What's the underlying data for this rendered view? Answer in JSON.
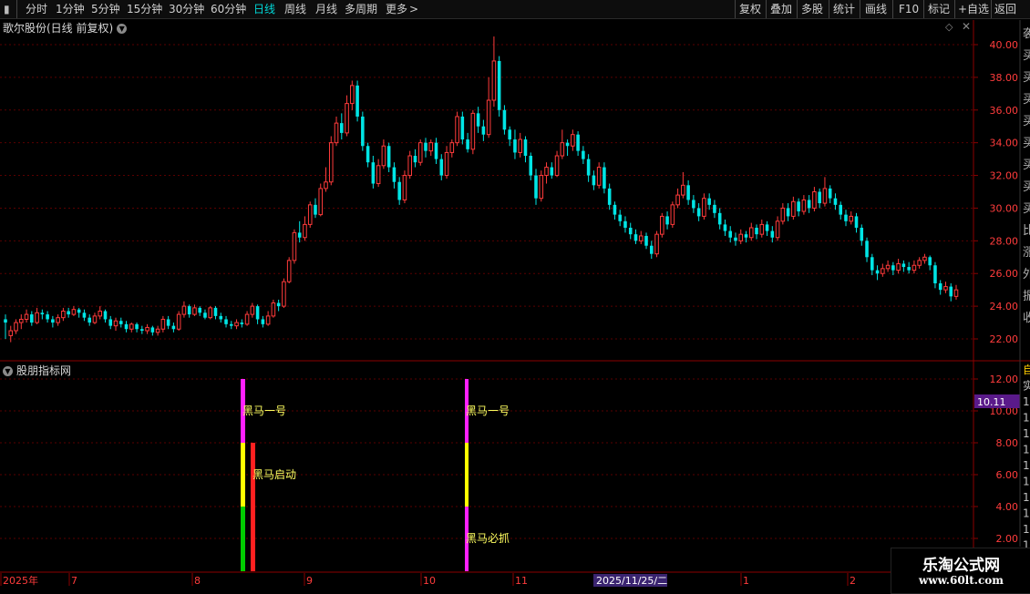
{
  "toolbar": {
    "periods": [
      "分时",
      "1分钟",
      "5分钟",
      "15分钟",
      "30分钟",
      "60分钟",
      "日线",
      "周线",
      "月线",
      "多周期",
      "更多"
    ],
    "active_period": "日线",
    "more_arrow": ">",
    "right_buttons": [
      "复权",
      "叠加",
      "多股",
      "统计",
      "画线",
      "F10",
      "标记",
      "+自选",
      "返回"
    ]
  },
  "main_chart": {
    "title": "歌尔股份(日线 前复权)",
    "y_ticks": [
      "40.00",
      "38.00",
      "36.00",
      "34.00",
      "32.00",
      "30.00",
      "28.00",
      "26.00",
      "24.00",
      "22.00"
    ],
    "colors": {
      "up": "#ff3b3b",
      "down": "#00e5e5",
      "grid": "#5a0000",
      "axis": "#8b0000",
      "tick_text": "#ff3c3c"
    }
  },
  "indicator": {
    "title": "股朋指标网",
    "y_ticks": [
      "12.00",
      "10.00",
      "8.00",
      "6.00",
      "4.00",
      "2.00"
    ],
    "current_value": "10.11",
    "labels": [
      "黑马一号",
      "黑马启动",
      "黑马一号",
      "黑马必抓"
    ],
    "colors": {
      "magenta": "#ff20ff",
      "yellow": "#ffff00",
      "green": "#00cc00",
      "red": "#ff2020",
      "label": "#ffff60",
      "value_bg": "#5a1a8a"
    }
  },
  "x_axis": {
    "labels": [
      "2025年",
      "7",
      "8",
      "9",
      "10",
      "11",
      "1",
      "2"
    ],
    "cursor_date": "2025/11/25/二"
  },
  "right_panel_strip": {
    "chars_top": [
      "袭",
      "买",
      "买",
      "买",
      "买",
      "买",
      "买",
      "买",
      "买",
      "比",
      "涨",
      "外",
      "振",
      "收"
    ],
    "chars_bottom": [
      "自",
      "实",
      "1",
      "1",
      "1",
      "1",
      "1",
      "1",
      "1",
      "1",
      "1",
      "1",
      "1"
    ]
  },
  "logo": {
    "line1": "乐淘公式网",
    "line2": "www.60lt.com"
  },
  "chart_data": {
    "type": "candlestick",
    "series": [
      {
        "values": [
          [
            23.2,
            23.0,
            23.5,
            22.0
          ],
          [
            22.2,
            22.5,
            22.8,
            21.8
          ],
          [
            22.5,
            23.0,
            23.2,
            22.3
          ],
          [
            23.0,
            23.2,
            23.5,
            22.6
          ],
          [
            23.2,
            23.5,
            23.8,
            23.0
          ],
          [
            23.5,
            23.0,
            23.7,
            22.8
          ],
          [
            23.0,
            23.6,
            23.9,
            22.9
          ],
          [
            23.6,
            23.5,
            23.8,
            23.2
          ],
          [
            23.5,
            23.2,
            23.7,
            23.0
          ],
          [
            23.2,
            23.0,
            23.4,
            22.7
          ],
          [
            23.0,
            23.3,
            23.5,
            22.8
          ],
          [
            23.3,
            23.7,
            23.9,
            23.1
          ],
          [
            23.7,
            23.5,
            23.9,
            23.3
          ],
          [
            23.5,
            23.8,
            24.0,
            23.4
          ],
          [
            23.8,
            23.6,
            23.9,
            23.3
          ],
          [
            23.6,
            23.3,
            23.8,
            23.1
          ],
          [
            23.3,
            23.0,
            23.5,
            22.8
          ],
          [
            23.0,
            23.4,
            23.6,
            22.9
          ],
          [
            23.4,
            23.7,
            24.0,
            23.2
          ],
          [
            23.7,
            23.2,
            23.8,
            23.0
          ],
          [
            23.2,
            22.8,
            23.4,
            22.6
          ],
          [
            22.8,
            23.1,
            23.3,
            22.5
          ],
          [
            23.1,
            22.9,
            23.3,
            22.7
          ],
          [
            22.9,
            22.6,
            23.1,
            22.4
          ],
          [
            22.6,
            22.9,
            23.0,
            22.4
          ],
          [
            22.9,
            22.6,
            23.0,
            22.4
          ],
          [
            22.6,
            22.5,
            22.8,
            22.3
          ],
          [
            22.5,
            22.7,
            22.9,
            22.3
          ],
          [
            22.7,
            22.4,
            22.8,
            22.2
          ],
          [
            22.4,
            22.6,
            22.8,
            22.2
          ],
          [
            22.6,
            23.2,
            23.4,
            22.4
          ],
          [
            23.2,
            22.8,
            23.4,
            22.6
          ],
          [
            22.8,
            22.6,
            23.0,
            22.4
          ],
          [
            22.6,
            23.5,
            23.7,
            22.5
          ],
          [
            23.5,
            24.0,
            24.3,
            23.3
          ],
          [
            24.0,
            23.5,
            24.1,
            23.3
          ],
          [
            23.5,
            23.9,
            24.1,
            23.4
          ],
          [
            23.9,
            23.6,
            24.0,
            23.4
          ],
          [
            23.6,
            23.3,
            23.8,
            23.2
          ],
          [
            23.3,
            23.9,
            24.0,
            23.2
          ],
          [
            23.9,
            23.4,
            24.0,
            23.2
          ],
          [
            23.4,
            23.2,
            23.6,
            23.0
          ],
          [
            23.2,
            22.9,
            23.4,
            22.7
          ],
          [
            22.9,
            22.8,
            23.1,
            22.6
          ],
          [
            22.8,
            23.0,
            23.2,
            22.6
          ],
          [
            23.0,
            22.9,
            23.2,
            22.7
          ],
          [
            22.9,
            23.5,
            23.7,
            22.8
          ],
          [
            23.5,
            24.0,
            24.2,
            23.3
          ],
          [
            24.0,
            23.2,
            24.1,
            22.9
          ],
          [
            23.2,
            22.9,
            23.4,
            22.7
          ],
          [
            22.9,
            23.4,
            23.7,
            22.8
          ],
          [
            23.4,
            24.2,
            24.4,
            23.3
          ],
          [
            24.2,
            24.0,
            24.4,
            23.7
          ],
          [
            24.0,
            25.5,
            25.7,
            23.9
          ],
          [
            25.5,
            26.8,
            27.0,
            25.4
          ],
          [
            26.8,
            28.5,
            28.7,
            26.6
          ],
          [
            28.5,
            28.2,
            29.2,
            27.9
          ],
          [
            28.2,
            29.0,
            29.5,
            28.0
          ],
          [
            29.0,
            30.2,
            30.4,
            28.8
          ],
          [
            30.2,
            29.6,
            30.6,
            29.4
          ],
          [
            29.6,
            31.2,
            31.5,
            29.5
          ],
          [
            31.2,
            31.6,
            32.5,
            31.0
          ],
          [
            31.6,
            34.0,
            34.4,
            31.4
          ],
          [
            34.0,
            35.2,
            35.6,
            33.8
          ],
          [
            35.2,
            34.6,
            35.8,
            34.2
          ],
          [
            34.6,
            36.4,
            36.9,
            34.4
          ],
          [
            36.4,
            37.5,
            37.8,
            36.0
          ],
          [
            37.5,
            35.6,
            37.8,
            35.3
          ],
          [
            35.6,
            33.8,
            35.9,
            33.5
          ],
          [
            33.8,
            32.8,
            34.0,
            32.5
          ],
          [
            32.8,
            31.5,
            33.2,
            31.2
          ],
          [
            31.5,
            32.6,
            33.0,
            31.3
          ],
          [
            32.6,
            33.8,
            34.2,
            32.4
          ],
          [
            33.8,
            32.5,
            34.0,
            32.2
          ],
          [
            32.5,
            31.6,
            32.8,
            31.2
          ],
          [
            31.6,
            30.5,
            31.9,
            30.2
          ],
          [
            30.5,
            32.0,
            32.3,
            30.3
          ],
          [
            32.0,
            33.2,
            33.5,
            31.8
          ],
          [
            33.2,
            32.8,
            33.6,
            32.5
          ],
          [
            32.8,
            34.0,
            34.2,
            32.6
          ],
          [
            34.0,
            33.5,
            34.3,
            33.1
          ],
          [
            33.5,
            34.0,
            34.2,
            33.2
          ],
          [
            34.0,
            33.0,
            34.3,
            32.7
          ],
          [
            33.0,
            32.0,
            33.3,
            31.7
          ],
          [
            32.0,
            33.4,
            33.8,
            31.8
          ],
          [
            33.4,
            34.0,
            34.2,
            33.1
          ],
          [
            34.0,
            35.6,
            35.9,
            33.8
          ],
          [
            35.6,
            34.2,
            35.9,
            33.9
          ],
          [
            34.2,
            33.6,
            34.6,
            33.4
          ],
          [
            33.6,
            35.8,
            36.0,
            33.3
          ],
          [
            35.8,
            35.0,
            36.2,
            34.6
          ],
          [
            35.0,
            34.5,
            35.4,
            34.1
          ],
          [
            34.5,
            36.6,
            38.0,
            34.3
          ],
          [
            36.6,
            39.0,
            40.5,
            36.2
          ],
          [
            39.0,
            36.0,
            39.3,
            35.6
          ],
          [
            36.0,
            34.8,
            36.3,
            34.5
          ],
          [
            34.8,
            34.2,
            35.0,
            33.8
          ],
          [
            34.2,
            33.4,
            34.8,
            33.0
          ],
          [
            33.4,
            34.2,
            34.6,
            33.1
          ],
          [
            34.2,
            33.2,
            34.4,
            32.8
          ],
          [
            33.2,
            32.0,
            33.4,
            31.7
          ],
          [
            32.0,
            30.6,
            32.4,
            30.2
          ],
          [
            30.6,
            32.0,
            32.3,
            30.4
          ],
          [
            32.0,
            32.5,
            32.8,
            31.5
          ],
          [
            32.5,
            32.0,
            32.8,
            31.8
          ],
          [
            32.0,
            33.2,
            33.5,
            31.9
          ],
          [
            33.2,
            34.0,
            34.8,
            33.0
          ],
          [
            34.0,
            33.8,
            34.2,
            33.2
          ],
          [
            33.8,
            34.5,
            34.8,
            33.5
          ],
          [
            34.5,
            33.5,
            34.7,
            33.2
          ],
          [
            33.5,
            33.0,
            33.8,
            32.7
          ],
          [
            33.0,
            32.0,
            33.3,
            31.6
          ],
          [
            32.0,
            31.4,
            32.3,
            31.1
          ],
          [
            31.4,
            32.5,
            32.8,
            31.2
          ],
          [
            32.5,
            31.2,
            32.8,
            30.9
          ],
          [
            31.2,
            30.2,
            31.5,
            29.9
          ],
          [
            30.2,
            29.6,
            30.4,
            29.3
          ],
          [
            29.6,
            29.2,
            29.9,
            28.9
          ],
          [
            29.2,
            28.8,
            29.5,
            28.5
          ],
          [
            28.8,
            28.4,
            29.1,
            28.1
          ],
          [
            28.4,
            28.0,
            28.7,
            27.8
          ],
          [
            28.0,
            28.3,
            28.6,
            27.8
          ],
          [
            28.3,
            27.7,
            28.5,
            27.5
          ],
          [
            27.7,
            27.2,
            28.0,
            26.9
          ],
          [
            27.2,
            28.4,
            28.6,
            27.0
          ],
          [
            28.4,
            29.5,
            29.7,
            28.2
          ],
          [
            29.5,
            29.0,
            29.8,
            28.7
          ],
          [
            29.0,
            30.2,
            30.4,
            28.8
          ],
          [
            30.2,
            30.8,
            31.2,
            30.0
          ],
          [
            30.8,
            31.4,
            32.2,
            30.6
          ],
          [
            31.4,
            30.5,
            31.7,
            30.2
          ],
          [
            30.5,
            30.0,
            30.8,
            29.7
          ],
          [
            30.0,
            29.5,
            30.3,
            29.2
          ],
          [
            29.5,
            30.6,
            30.9,
            29.3
          ],
          [
            30.6,
            30.2,
            30.9,
            29.9
          ],
          [
            30.2,
            29.7,
            30.5,
            29.4
          ],
          [
            29.7,
            29.0,
            30.0,
            28.7
          ],
          [
            29.0,
            28.6,
            29.3,
            28.3
          ],
          [
            28.6,
            28.2,
            28.9,
            27.9
          ],
          [
            28.2,
            28.0,
            28.5,
            27.7
          ],
          [
            28.0,
            28.4,
            28.7,
            27.8
          ],
          [
            28.4,
            28.2,
            28.6,
            27.9
          ],
          [
            28.2,
            28.8,
            29.1,
            28.0
          ],
          [
            28.8,
            28.4,
            29.0,
            28.1
          ],
          [
            28.4,
            29.0,
            29.3,
            28.2
          ],
          [
            29.0,
            28.6,
            29.2,
            28.3
          ],
          [
            28.6,
            28.2,
            28.9,
            27.9
          ],
          [
            28.2,
            29.2,
            29.5,
            28.0
          ],
          [
            29.2,
            30.0,
            30.3,
            29.0
          ],
          [
            30.0,
            29.5,
            30.3,
            29.2
          ],
          [
            29.5,
            30.4,
            30.7,
            29.3
          ],
          [
            30.4,
            29.8,
            30.6,
            29.5
          ],
          [
            29.8,
            30.5,
            30.8,
            29.6
          ],
          [
            30.5,
            30.0,
            30.8,
            29.7
          ],
          [
            30.0,
            31.0,
            31.3,
            29.8
          ],
          [
            31.0,
            30.3,
            31.2,
            30.0
          ],
          [
            30.3,
            31.2,
            31.9,
            30.1
          ],
          [
            31.2,
            30.6,
            31.4,
            30.3
          ],
          [
            30.6,
            30.2,
            30.9,
            29.9
          ],
          [
            30.2,
            29.6,
            30.4,
            29.3
          ],
          [
            29.6,
            29.2,
            29.9,
            28.9
          ],
          [
            29.2,
            29.5,
            29.8,
            29.0
          ],
          [
            29.5,
            28.8,
            29.7,
            28.5
          ],
          [
            28.8,
            28.0,
            29.0,
            27.7
          ],
          [
            28.0,
            27.0,
            28.2,
            26.7
          ],
          [
            27.0,
            26.2,
            27.2,
            25.9
          ],
          [
            26.2,
            26.0,
            26.5,
            25.6
          ],
          [
            26.0,
            26.3,
            26.6,
            25.8
          ],
          [
            26.3,
            26.5,
            26.8,
            26.1
          ],
          [
            26.5,
            26.2,
            26.7,
            25.9
          ],
          [
            26.2,
            26.6,
            26.9,
            26.0
          ],
          [
            26.6,
            26.4,
            26.8,
            26.1
          ],
          [
            26.4,
            26.2,
            26.7,
            26.0
          ],
          [
            26.2,
            26.5,
            26.8,
            26.0
          ],
          [
            26.5,
            26.8,
            27.0,
            26.3
          ],
          [
            26.8,
            27.0,
            27.2,
            26.6
          ],
          [
            27.0,
            26.5,
            27.1,
            26.2
          ],
          [
            26.5,
            25.4,
            26.7,
            25.1
          ],
          [
            25.4,
            25.0,
            25.6,
            24.7
          ],
          [
            25.0,
            25.2,
            25.5,
            24.8
          ],
          [
            25.2,
            24.6,
            25.4,
            24.3
          ],
          [
            24.6,
            25.0,
            25.3,
            24.4
          ]
        ]
      }
    ],
    "indicator_signals": [
      {
        "label": "黑马一号",
        "level": 12
      },
      {
        "label": "黑马启动",
        "level": 8
      },
      {
        "label": "黑马一号",
        "level": 12
      },
      {
        "label": "黑马必抓",
        "level": 4
      }
    ]
  }
}
